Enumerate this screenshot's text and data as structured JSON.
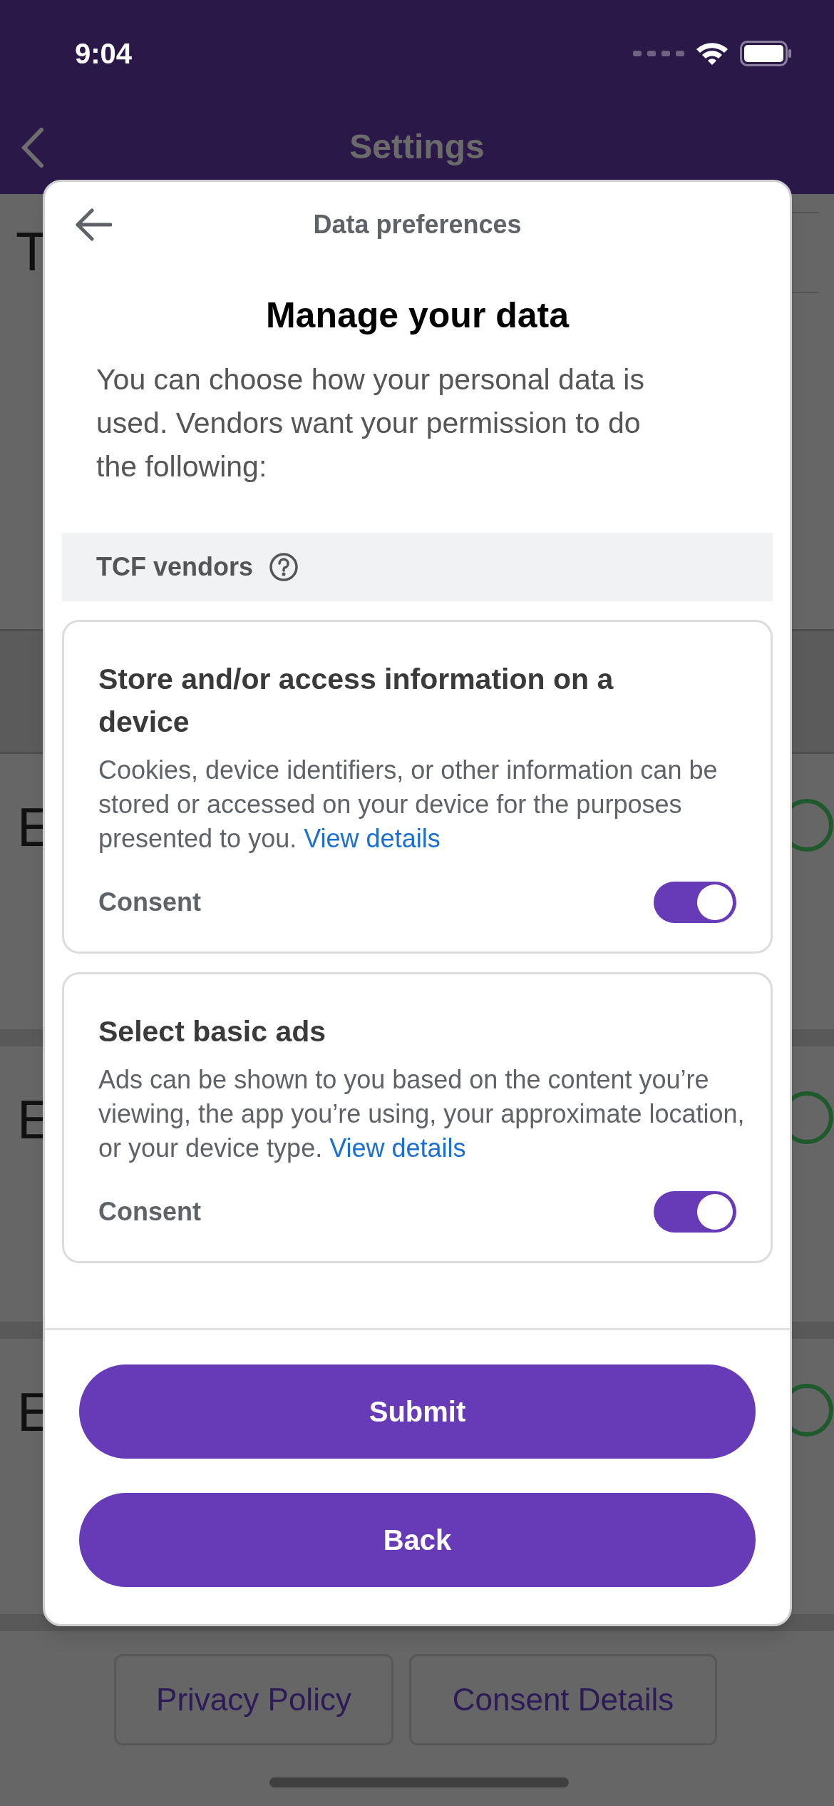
{
  "status_bar": {
    "time": "9:04"
  },
  "nav_bar": {
    "title": "Settings"
  },
  "background": {
    "sections": [
      {
        "kind": "text_block",
        "heading": "T"
      },
      {
        "kind": "group_header"
      },
      {
        "kind": "toggle_row",
        "heading": "E"
      },
      {
        "kind": "toggle_row",
        "heading": "E"
      },
      {
        "kind": "toggle_row",
        "heading": "E"
      }
    ],
    "buttons": [
      "Privacy Policy",
      "Consent Details"
    ]
  },
  "dialog": {
    "header_title": "Data preferences",
    "title": "Manage your data",
    "intro": "You can choose how your personal data is used. Vendors want your permission to do the following:",
    "section_label": "TCF vendors",
    "purposes": [
      {
        "title": "Store and/or access information on a device",
        "description": "Cookies, device identifiers, or other information can be stored or accessed on your device for the purposes presented to you.",
        "link": "View details",
        "consent_label": "Consent",
        "on": true
      },
      {
        "title": "Select basic ads",
        "description": "Ads can be shown to you based on the content you’re viewing, the app you’re using, your approximate location, or your device type.",
        "link": "View details",
        "consent_label": "Consent",
        "on": true
      }
    ],
    "buttons": [
      "Submit",
      "Back"
    ]
  }
}
